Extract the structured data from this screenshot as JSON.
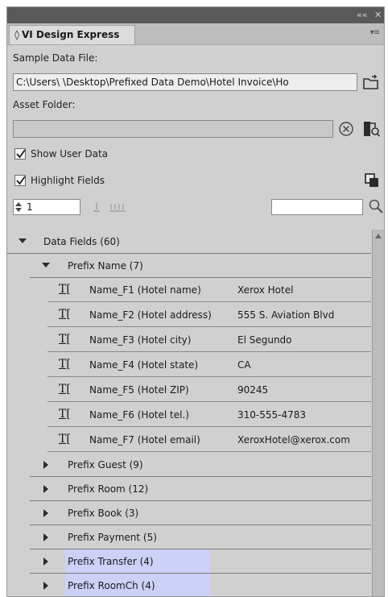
{
  "panel": {
    "title": "VI Design Express",
    "title_chevron": "◊",
    "menu_glyph": "▾≡",
    "collapse_glyph": "««",
    "close_glyph": "✕"
  },
  "sample_data": {
    "label": "Sample Data File:",
    "value": "C:\\Users\\              \\Desktop\\Prefixed Data Demo\\Hotel Invoice\\Ho"
  },
  "asset_folder": {
    "label": "Asset Folder:",
    "value": ""
  },
  "options": {
    "show_user_data": "Show User Data",
    "highlight_fields": "Highlight Fields"
  },
  "record": {
    "value": "1",
    "search_value": ""
  },
  "tree": {
    "root_label": "Data Fields (60)",
    "expanded_group": "Prefix Name (7)",
    "fields": [
      {
        "name": "Name_F1 (Hotel name)",
        "value": "Xerox Hotel"
      },
      {
        "name": "Name_F2 (Hotel address)",
        "value": "555 S. Aviation Blvd"
      },
      {
        "name": "Name_F3 (Hotel city)",
        "value": "El Segundo"
      },
      {
        "name": "Name_F4 (Hotel state)",
        "value": "CA"
      },
      {
        "name": "Name_F5 (Hotel ZIP)",
        "value": "90245"
      },
      {
        "name": "Name_F6 (Hotel tel.)",
        "value": "310-555-4783"
      },
      {
        "name": "Name_F7 (Hotel email)",
        "value": "XeroxHotel@xerox.com"
      }
    ],
    "collapsed_groups": [
      {
        "label": "Prefix Guest (9)",
        "highlighted": false
      },
      {
        "label": "Prefix Room (12)",
        "highlighted": false
      },
      {
        "label": "Prefix Book (3)",
        "highlighted": false
      },
      {
        "label": "Prefix Payment (5)",
        "highlighted": false
      },
      {
        "label": "Prefix Transfer (4)",
        "highlighted": true
      },
      {
        "label": "Prefix RoomCh (4)",
        "highlighted": true
      }
    ],
    "text_field_glyph": "T[",
    "highlight_color": "#cdd0f7"
  }
}
